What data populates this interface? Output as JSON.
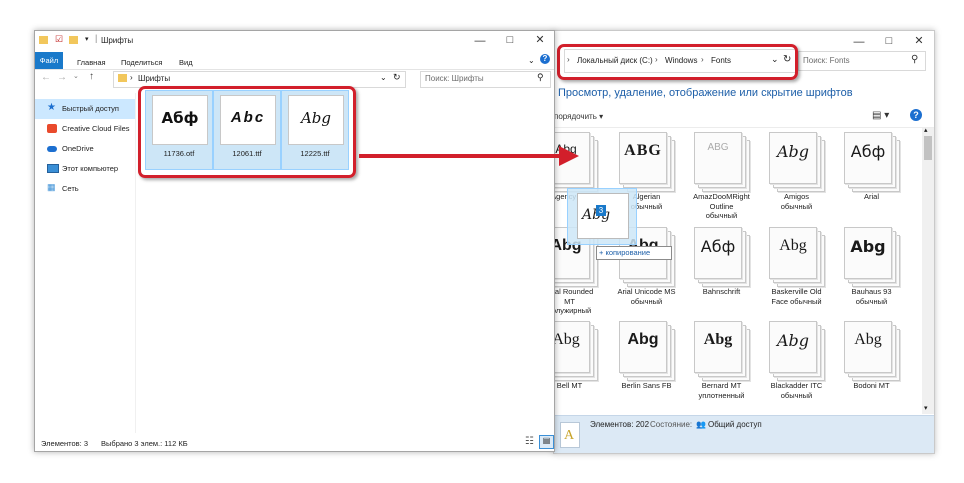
{
  "left_window": {
    "title": "Шрифты",
    "tabs": {
      "file": "Файл",
      "home": "Главная",
      "share": "Поделиться",
      "view": "Вид"
    },
    "address": "Шрифты",
    "search_placeholder": "Поиск: Шрифты",
    "sidebar": [
      {
        "label": "Быстрый доступ",
        "icon": "star-icon"
      },
      {
        "label": "Creative Cloud Files",
        "icon": "creative-cloud-icon"
      },
      {
        "label": "OneDrive",
        "icon": "cloud-icon"
      },
      {
        "label": "Этот компьютер",
        "icon": "computer-icon"
      },
      {
        "label": "Сеть",
        "icon": "network-icon"
      }
    ],
    "files": [
      {
        "name": "11736.otf",
        "sample": "Абф"
      },
      {
        "name": "12061.ttf",
        "sample": "Abc"
      },
      {
        "name": "12225.ttf",
        "sample": "Abg"
      }
    ],
    "status": {
      "items": "Элементов: 3",
      "selected": "Выбрано 3 элем.: 112 КБ"
    }
  },
  "right_window": {
    "address": {
      "part1": "Локальный диск (C:)",
      "part2": "Windows",
      "part3": "Fonts"
    },
    "search_placeholder": "Поиск: Fonts",
    "heading": "Просмотр, удаление, отображение или скрытие шрифтов",
    "arrange_label": "порядочить",
    "fonts": [
      {
        "name": "Agency FB",
        "sample": "Abg"
      },
      {
        "name": "Algerian\nобычный",
        "sample": "ABG"
      },
      {
        "name": "AmazDooMRight\nOutline\nобычный",
        "sample": "ABG"
      },
      {
        "name": "Amigos\nобычный",
        "sample": "Abg"
      },
      {
        "name": "Arial",
        "sample": "Абф"
      },
      {
        "name": "Arial Rounded\nMT\nполужирный",
        "sample": "Abg"
      },
      {
        "name": "Arial Unicode MS\nобычный",
        "sample": "Abg"
      },
      {
        "name": "Bahnschrift",
        "sample": "Абф"
      },
      {
        "name": "Baskerville Old\nFace обычный",
        "sample": "Abg"
      },
      {
        "name": "Bauhaus 93\nобычный",
        "sample": "Abg"
      },
      {
        "name": "Bell MT",
        "sample": "Abg"
      },
      {
        "name": "Berlin Sans FB",
        "sample": "Abg"
      },
      {
        "name": "Bernard MT\nуплотненный",
        "sample": "Abg"
      },
      {
        "name": "Blackadder ITC\nобычный",
        "sample": "Abg"
      },
      {
        "name": "Bodoni MT",
        "sample": "Abg"
      }
    ],
    "status": {
      "items": "Элементов: 202",
      "state_label": "Состояние:",
      "state_value": "Общий доступ"
    }
  },
  "drag": {
    "badge": "3",
    "sample": "Abg",
    "tooltip": "+ копирование"
  }
}
